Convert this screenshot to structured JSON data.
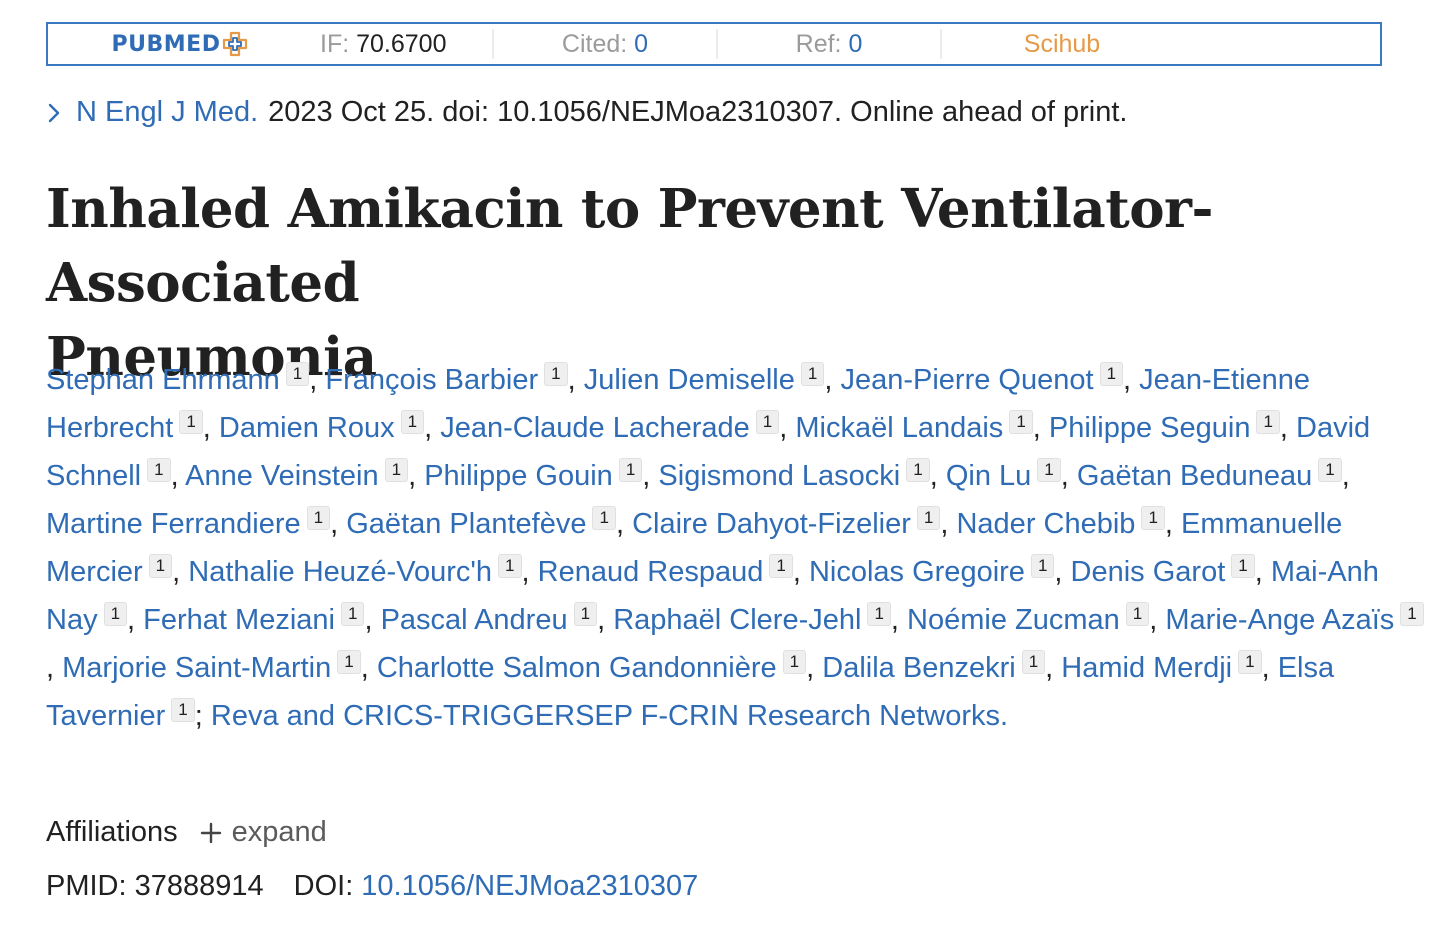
{
  "infobar": {
    "logo_text": "PUBMED",
    "if_label": "IF:",
    "if_value": "70.6700",
    "cited_label": "Cited:",
    "cited_value": "0",
    "ref_label": "Ref:",
    "ref_value": "0",
    "scihub_label": "Scihub",
    "colors": {
      "border": "#3a78c0",
      "brand": "#2f6cb5",
      "scihub": "#e69a48"
    }
  },
  "citation": {
    "icon": "chevron-right-icon",
    "journal": "N Engl J Med.",
    "details": "2023 Oct 25. doi: 10.1056/NEJMoa2310307. Online ahead of print."
  },
  "title": {
    "line1": "Inhaled Amikacin to Prevent Ventilator-Associated",
    "line2": "Pneumonia"
  },
  "authors": [
    {
      "name": "Stephan Ehrmann",
      "aff": "1"
    },
    {
      "name": "François Barbier",
      "aff": "1"
    },
    {
      "name": "Julien Demiselle",
      "aff": "1"
    },
    {
      "name": "Jean-Pierre Quenot",
      "aff": "1"
    },
    {
      "name": "Jean-Etienne Herbrecht",
      "aff": "1"
    },
    {
      "name": "Damien Roux",
      "aff": "1"
    },
    {
      "name": "Jean-Claude Lacherade",
      "aff": "1"
    },
    {
      "name": "Mickaël Landais",
      "aff": "1"
    },
    {
      "name": "Philippe Seguin",
      "aff": "1"
    },
    {
      "name": "David Schnell",
      "aff": "1"
    },
    {
      "name": "Anne Veinstein",
      "aff": "1"
    },
    {
      "name": "Philippe Gouin",
      "aff": "1"
    },
    {
      "name": "Sigismond Lasocki",
      "aff": "1"
    },
    {
      "name": "Qin Lu",
      "aff": "1"
    },
    {
      "name": "Gaëtan Beduneau",
      "aff": "1"
    },
    {
      "name": "Martine Ferrandiere",
      "aff": "1"
    },
    {
      "name": "Gaëtan Plantefève",
      "aff": "1"
    },
    {
      "name": "Claire Dahyot-Fizelier",
      "aff": "1"
    },
    {
      "name": "Nader Chebib",
      "aff": "1"
    },
    {
      "name": "Emmanuelle Mercier",
      "aff": "1"
    },
    {
      "name": "Nathalie Heuzé-Vourc'h",
      "aff": "1"
    },
    {
      "name": "Renaud Respaud",
      "aff": "1"
    },
    {
      "name": "Nicolas Gregoire",
      "aff": "1"
    },
    {
      "name": "Denis Garot",
      "aff": "1"
    },
    {
      "name": "Mai-Anh Nay",
      "aff": "1"
    },
    {
      "name": "Ferhat Meziani",
      "aff": "1"
    },
    {
      "name": "Pascal Andreu",
      "aff": "1"
    },
    {
      "name": "Raphaël Clere-Jehl",
      "aff": "1"
    },
    {
      "name": "Noémie Zucman",
      "aff": "1"
    },
    {
      "name": "Marie-Ange Azaïs",
      "aff": "1"
    },
    {
      "name": "Marjorie Saint-Martin",
      "aff": "1"
    },
    {
      "name": "Charlotte Salmon Gandonnière",
      "aff": "1"
    },
    {
      "name": "Dalila Benzekri",
      "aff": "1"
    },
    {
      "name": "Hamid Merdji",
      "aff": "1"
    },
    {
      "name": "Elsa Tavernier",
      "aff": "1"
    }
  ],
  "group_author": "Reva and CRICS-TRIGGERSEP F-CRIN Research Networks.",
  "affiliations": {
    "label": "Affiliations",
    "expand_label": "expand",
    "icon": "plus-icon"
  },
  "ids": {
    "pmid_label": "PMID:",
    "pmid_value": "37888914",
    "doi_label": "DOI:",
    "doi_value": "10.1056/NEJMoa2310307"
  }
}
